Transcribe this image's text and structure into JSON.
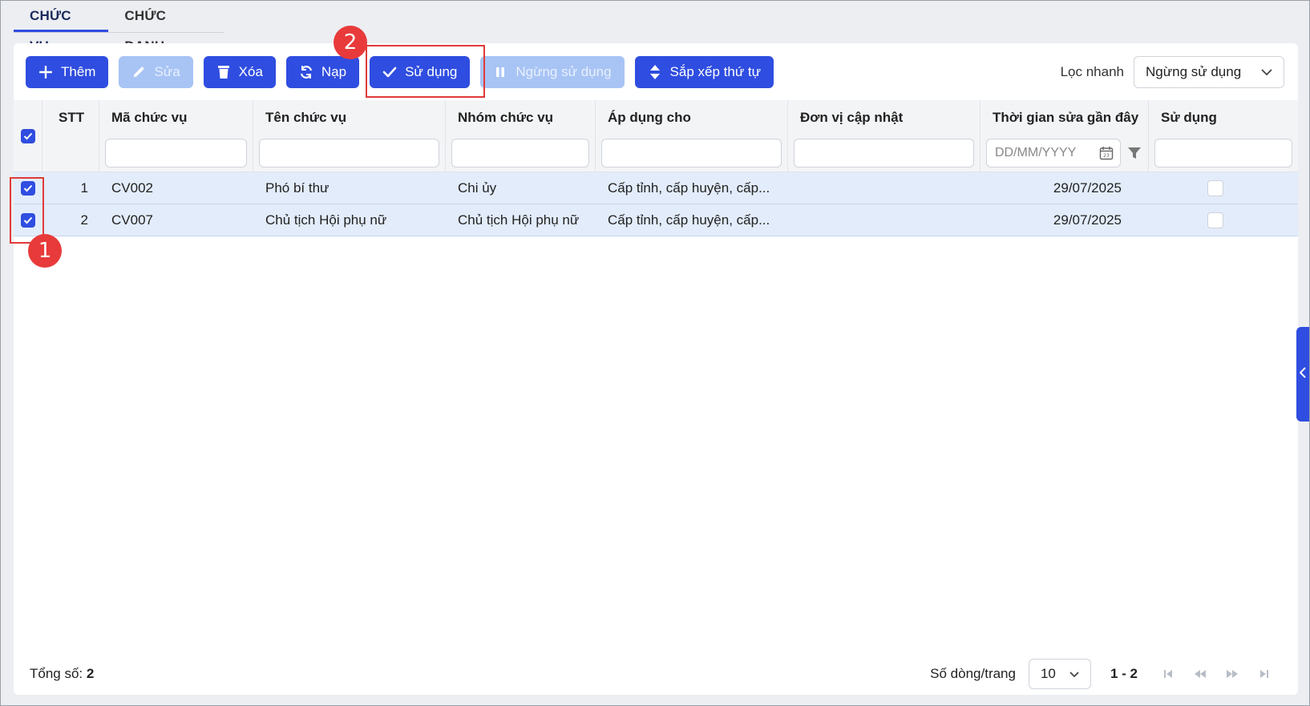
{
  "tabs": [
    {
      "label": "CHỨC VỤ"
    },
    {
      "label": "CHỨC DANH"
    }
  ],
  "toolbar": {
    "add": "Thêm",
    "edit": "Sửa",
    "delete": "Xóa",
    "reload": "Nạp",
    "use": "Sử dụng",
    "stop_use": "Ngừng sử dụng",
    "sort": "Sắp xếp thứ tự"
  },
  "quick_filter": {
    "label": "Lọc nhanh",
    "value": "Ngừng sử dụng"
  },
  "annotations": {
    "step1": "1",
    "step2": "2"
  },
  "columns": {
    "stt": "STT",
    "code": "Mã chức vụ",
    "name": "Tên chức vụ",
    "group": "Nhóm chức vụ",
    "apply": "Áp dụng cho",
    "unit": "Đơn vị cập nhật",
    "updated": "Thời gian sửa gần đây",
    "use": "Sử dụng"
  },
  "filters": {
    "date_placeholder": "DD/MM/YYYY",
    "date_icon_text": "23"
  },
  "rows": [
    {
      "stt": "1",
      "code": "CV002",
      "name": "Phó bí thư",
      "group": "Chi ủy",
      "apply": "Cấp tỉnh, cấp huyện, cấp...",
      "unit": "",
      "updated": "29/07/2025",
      "use": false,
      "checked": true
    },
    {
      "stt": "2",
      "code": "CV007",
      "name": "Chủ tịch Hội phụ nữ",
      "group": "Chủ tịch Hội phụ nữ",
      "apply": "Cấp tỉnh, cấp huyện, cấp...",
      "unit": "",
      "updated": "29/07/2025",
      "use": false,
      "checked": true
    }
  ],
  "footer": {
    "total_label": "Tổng số:",
    "total_value": "2",
    "rows_per_page_label": "Số dòng/trang",
    "rows_per_page": "10",
    "range": "1 - 2"
  },
  "colors": {
    "primary": "#2f4de0",
    "disabled": "#a8c4f5",
    "row_selected": "#e3ecfb",
    "annotation": "#e83a3a"
  }
}
